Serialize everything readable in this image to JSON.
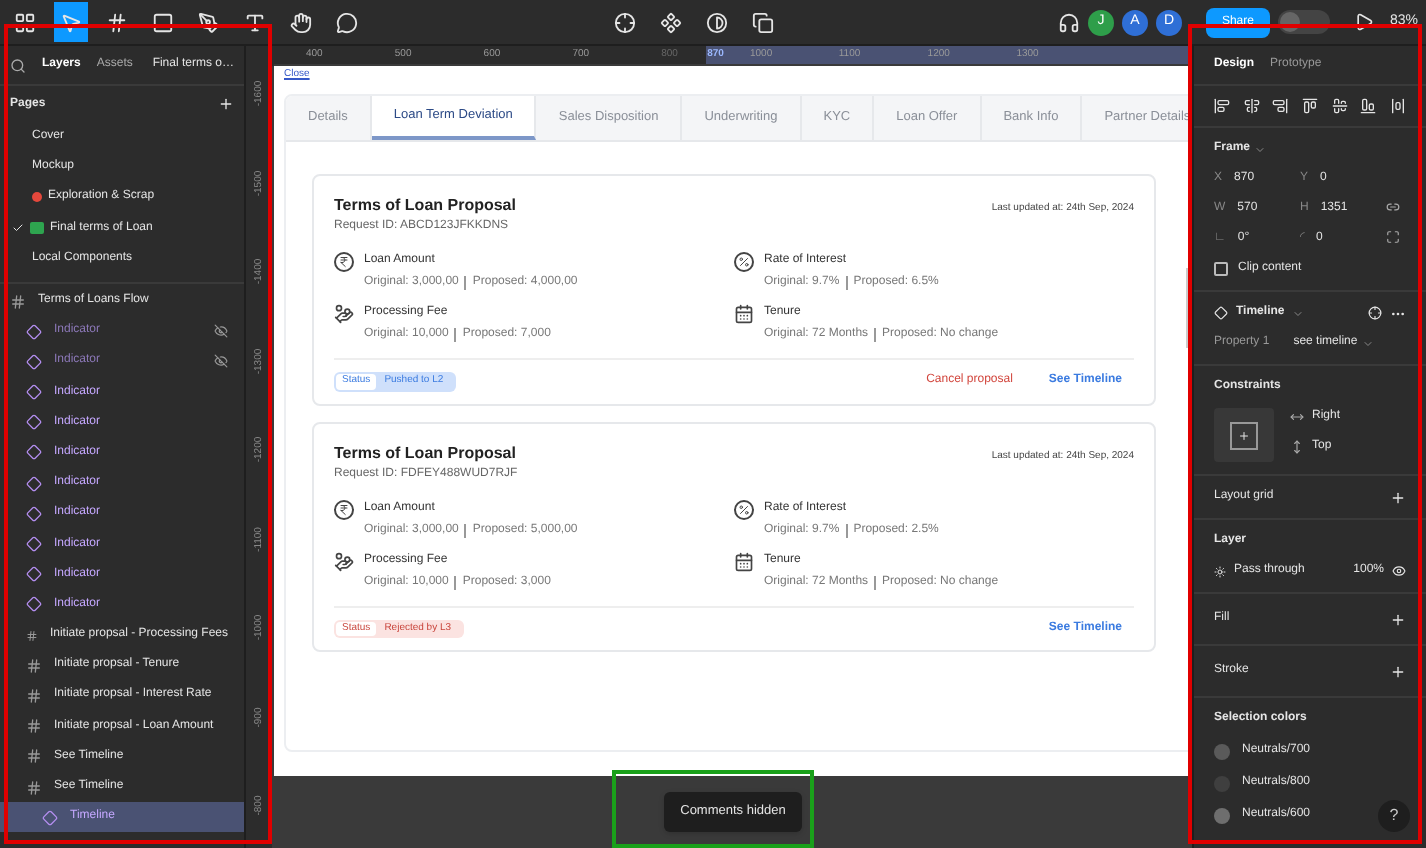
{
  "toolbar": {
    "share_label": "Share",
    "dev_mode_on": false,
    "zoom": "83%",
    "avatars": [
      {
        "initial": "J",
        "color": "#2e9e4a"
      },
      {
        "initial": "A",
        "color": "#2f6fd6"
      },
      {
        "initial": "D",
        "color": "#2f6fd6"
      }
    ]
  },
  "ruler": {
    "x_ticks": [
      {
        "label": "400",
        "kind": "normal"
      },
      {
        "label": "500",
        "kind": "normal"
      },
      {
        "label": "600",
        "kind": "normal"
      },
      {
        "label": "700",
        "kind": "normal"
      },
      {
        "label": "800",
        "kind": "dim"
      },
      {
        "label": "870",
        "kind": "selection"
      },
      {
        "label": "1000",
        "kind": "normal"
      },
      {
        "label": "1100",
        "kind": "normal"
      },
      {
        "label": "1200",
        "kind": "normal"
      },
      {
        "label": "1300",
        "kind": "normal"
      }
    ],
    "y_ticks": [
      "-1600",
      "-1500",
      "-1400",
      "-1300",
      "-1200",
      "-1100",
      "-1000",
      "-900",
      "-800"
    ]
  },
  "left_panel": {
    "tabs": [
      {
        "label": "Layers",
        "selected": true
      },
      {
        "label": "Assets",
        "selected": false
      }
    ],
    "file_name": "Final terms o…",
    "pages_heading": "Pages",
    "pages": [
      {
        "label": "Cover",
        "selected": false,
        "kind": "plain"
      },
      {
        "label": "Mockup",
        "selected": false,
        "kind": "plain"
      },
      {
        "label": "Exploration & Scrap",
        "selected": false,
        "kind": "status_dot"
      },
      {
        "label": "Final terms of Loan",
        "selected": true,
        "kind": "code"
      },
      {
        "label": "Local Components",
        "selected": false,
        "kind": "plain"
      }
    ],
    "layers": [
      {
        "label": "Terms of Loans Flow",
        "kind": "frame",
        "selected": false,
        "hidden": false,
        "children": [
          {
            "label": "Indicator",
            "kind": "instance",
            "selected": false,
            "hidden": true
          },
          {
            "label": "Indicator",
            "kind": "instance",
            "selected": false,
            "hidden": true
          },
          {
            "label": "Indicator",
            "kind": "instance",
            "selected": false,
            "hidden": false
          },
          {
            "label": "Indicator",
            "kind": "instance",
            "selected": false,
            "hidden": false
          },
          {
            "label": "Indicator",
            "kind": "instance",
            "selected": false,
            "hidden": false
          },
          {
            "label": "Indicator",
            "kind": "instance",
            "selected": false,
            "hidden": false
          },
          {
            "label": "Indicator",
            "kind": "instance",
            "selected": false,
            "hidden": false
          },
          {
            "label": "Indicator",
            "kind": "instance",
            "selected": false,
            "hidden": false
          },
          {
            "label": "Indicator",
            "kind": "instance",
            "selected": false,
            "hidden": false
          },
          {
            "label": "Indicator",
            "kind": "instance",
            "selected": false,
            "hidden": false
          },
          {
            "label": "Initiate propsal - Processing Fees",
            "kind": "frame",
            "selected": false,
            "hidden": false
          },
          {
            "label": "Initiate propsal - Tenure",
            "kind": "frame",
            "selected": false,
            "hidden": false
          },
          {
            "label": "Initiate propsal - Interest Rate",
            "kind": "frame",
            "selected": false,
            "hidden": false
          },
          {
            "label": "Initiate propsal - Loan Amount",
            "kind": "frame",
            "selected": false,
            "hidden": false
          },
          {
            "label": "See Timeline",
            "kind": "frame",
            "selected": false,
            "hidden": false
          },
          {
            "label": "See Timeline",
            "kind": "frame",
            "selected": false,
            "hidden": false,
            "children": [
              {
                "label": "Timeline",
                "kind": "instance",
                "selected": true,
                "hidden": false
              }
            ]
          }
        ]
      }
    ]
  },
  "canvas": {
    "link": "Close",
    "tabs": [
      {
        "label": "Details",
        "selected": false
      },
      {
        "label": "Loan Term Deviation",
        "selected": true
      },
      {
        "label": "Sales Disposition",
        "selected": false
      },
      {
        "label": "Underwriting",
        "selected": false
      },
      {
        "label": "KYC",
        "selected": false
      },
      {
        "label": "Loan Offer",
        "selected": false
      },
      {
        "label": "Bank Info",
        "selected": false
      },
      {
        "label": "Partner Details",
        "selected": false
      }
    ],
    "cards": [
      {
        "title": "Terms of Loan Proposal",
        "request_id": "Request ID: ABCD123JFKKDNS",
        "updated": "Last updated at: 24th Sep, 2024",
        "fields": [
          {
            "kind": "amount",
            "label": "Loan Amount",
            "original": "Original: 3,000,00",
            "proposed": "Proposed: 4,000,00"
          },
          {
            "kind": "rate",
            "label": "Rate of Interest",
            "original": "Original: 9.7%",
            "proposed": "Proposed: 6.5%"
          },
          {
            "kind": "fee",
            "label": "Processing Fee",
            "original": "Original: 10,000",
            "proposed": "Proposed: 7,000"
          },
          {
            "kind": "tenure",
            "label": "Tenure",
            "original": "Original: 72 Months",
            "proposed": "Proposed: No change"
          }
        ],
        "status": {
          "label": "Status",
          "value": "Pushed to L2",
          "kind": "pushed"
        },
        "cancel": "Cancel proposal",
        "timeline": "See Timeline"
      },
      {
        "title": "Terms of Loan Proposal",
        "request_id": "Request ID: FDFEY488WUD7RJF",
        "updated": "Last updated at: 24th Sep, 2024",
        "fields": [
          {
            "kind": "amount",
            "label": "Loan Amount",
            "original": "Original: 3,000,00",
            "proposed": "Proposed: 5,000,00"
          },
          {
            "kind": "rate",
            "label": "Rate of Interest",
            "original": "Original: 9.7%",
            "proposed": "Proposed: 2.5%"
          },
          {
            "kind": "fee",
            "label": "Processing Fee",
            "original": "Original: 10,000",
            "proposed": "Proposed: 3,000"
          },
          {
            "kind": "tenure",
            "label": "Tenure",
            "original": "Original: 72 Months",
            "proposed": "Proposed: No change"
          }
        ],
        "status": {
          "label": "Status",
          "value": "Rejected by L3",
          "kind": "rejected"
        },
        "timeline": "See Timeline"
      }
    ],
    "toast": "Comments hidden"
  },
  "right_panel": {
    "tabs": [
      {
        "label": "Design",
        "selected": true
      },
      {
        "label": "Prototype",
        "selected": false
      }
    ],
    "frame": {
      "heading": "Frame",
      "fields": [
        {
          "label": "X",
          "value": "870"
        },
        {
          "label": "Y",
          "value": "0"
        },
        {
          "label": "W",
          "value": "570"
        },
        {
          "label": "H",
          "value": "1351"
        },
        {
          "label": "∟",
          "value": "0°"
        },
        {
          "label": "◜",
          "value": "0"
        }
      ],
      "clip_label": "Clip content",
      "clip_checked": false
    },
    "component": {
      "name": "Timeline",
      "property_label": "Property 1",
      "property_value": "see timeline"
    },
    "constraints": {
      "heading": "Constraints",
      "horizontal": "Right",
      "vertical": "Top"
    },
    "layout_grid": "Layout grid",
    "layer": {
      "heading": "Layer",
      "blend": "Pass through",
      "opacity": "100%"
    },
    "fill": "Fill",
    "stroke": "Stroke",
    "selection_colors": {
      "heading": "Selection colors",
      "items": [
        {
          "name": "Neutrals/700",
          "color": "#5a5a5a"
        },
        {
          "name": "Neutrals/800",
          "color": "#3f3f3f"
        },
        {
          "name": "Neutrals/600",
          "color": "#6e6e6e"
        }
      ]
    },
    "help": "?"
  }
}
